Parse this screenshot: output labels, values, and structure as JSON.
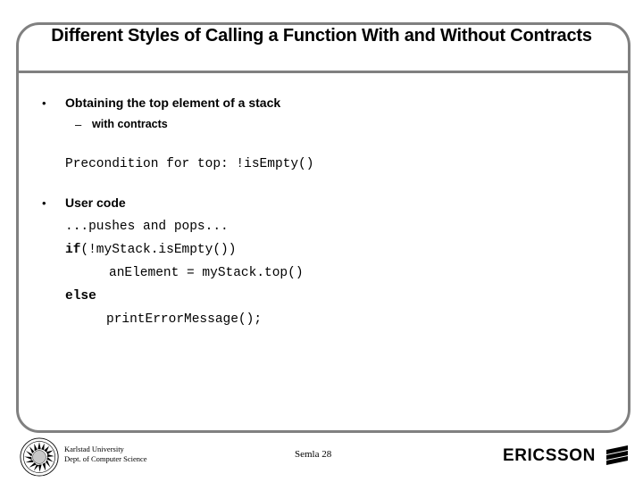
{
  "slide": {
    "title": "Different Styles of Calling a Function With and Without Contracts",
    "accent_color": "#808080",
    "text_color": "#000000",
    "background_color": "#ffffff"
  },
  "content": {
    "bullet1": {
      "marker": "•",
      "label": "Obtaining the top element of a stack"
    },
    "subbullet1": {
      "marker": "–",
      "label": "with contracts"
    },
    "precondition": "Precondition for top: !isEmpty()",
    "bullet2": {
      "marker": "•",
      "label": "User code"
    },
    "code": {
      "line_pushes": "...pushes and pops...",
      "line_if_keyword": "if",
      "line_if_rest": "(!myStack.isEmpty())",
      "line_assign": "anElement = myStack.top()",
      "line_else_keyword": "else",
      "line_print": "printErrorMessage();"
    }
  },
  "footer": {
    "university_line1": "Karlstad University",
    "university_line2": "Dept. of Computer Science",
    "slide_number": "Semla 28",
    "brand": "ERICSSON",
    "seal_rim_text": "KARLSTAD UNIVERSITY"
  }
}
